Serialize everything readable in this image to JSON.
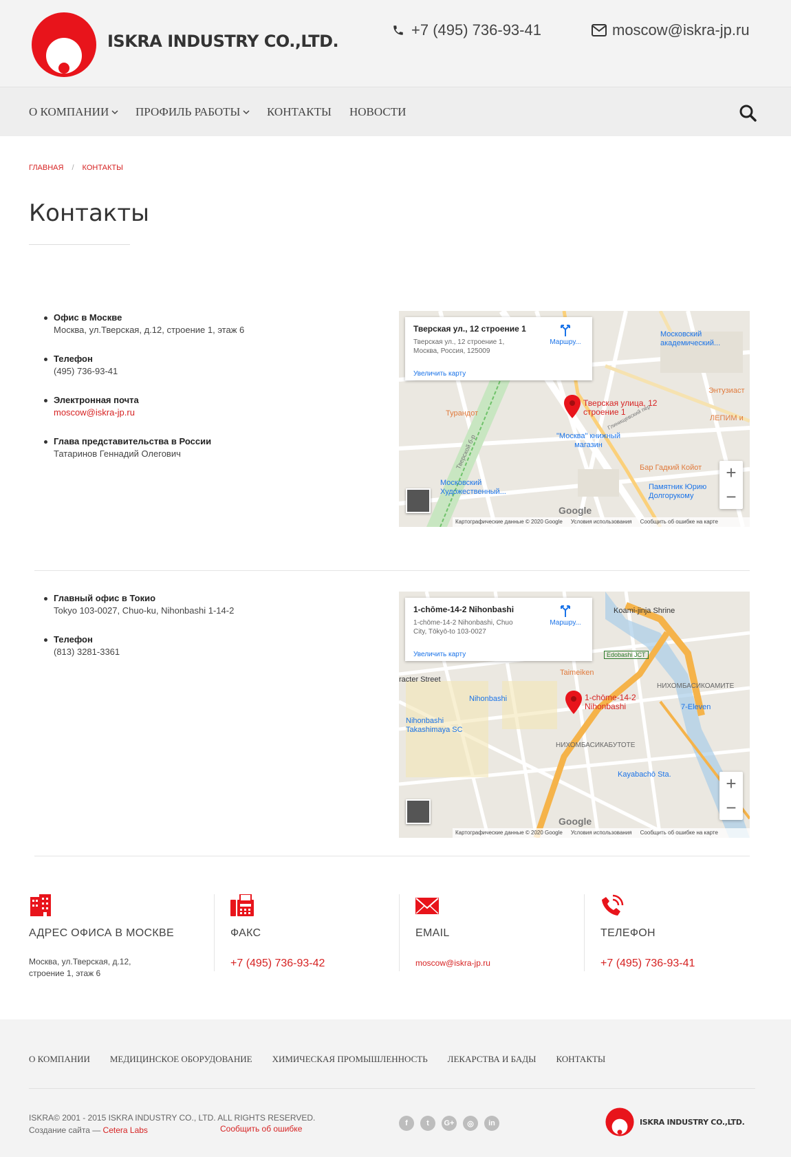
{
  "header": {
    "brand": "ISKRA INDUSTRY CO.,LTD.",
    "phone": "+7 (495) 736-93-41",
    "email": "moscow@iskra-jp.ru",
    "accent_color": "#e8141b"
  },
  "nav": {
    "items": [
      {
        "label": "О КОМПАНИИ",
        "dropdown": true
      },
      {
        "label": "ПРОФИЛЬ РАБОТЫ",
        "dropdown": true
      },
      {
        "label": "КОНТАКТЫ",
        "dropdown": false
      },
      {
        "label": "НОВОСТИ",
        "dropdown": false
      }
    ]
  },
  "breadcrumb": {
    "home": "ГЛАВНАЯ",
    "separator": "/",
    "current": "КОНТАКТЫ"
  },
  "page": {
    "title": "Контакты"
  },
  "moscow": {
    "items": [
      {
        "label": "Офис в Москве",
        "value": "Москва, ул.Тверская, д.12, строение 1, этаж 6"
      },
      {
        "label": "Телефон",
        "value": "(495) 736-93-41"
      },
      {
        "label": "Электронная почта",
        "value": "moscow@iskra-jp.ru"
      },
      {
        "label": "Глава представительства в России",
        "value": "Татаринов Геннадий Олегович"
      }
    ],
    "map": {
      "card_title": "Тверская ул., 12 строение 1",
      "card_address": "Тверская ул., 12 строение 1, Москва, Россия, 125009",
      "zoom_link": "Увеличить карту",
      "route": "Маршру...",
      "pin_label": "Тверская улица, 12 строение 1",
      "labels": [
        "Московский академический...",
        "Турандот",
        "\"Москва\" книжный магазин",
        "Бар Гадкий Койот",
        "Памятник Юрию Долгорукому",
        "Московский Художественный...",
        "Энтузиаст",
        "ЛЕПИМ и",
        "Тверской б-р",
        "Глинищевский пер"
      ],
      "attribution": [
        "Картографические данные © 2020 Google",
        "Условия использования",
        "Сообщить об ошибке на карте"
      ],
      "google": "Google",
      "zoom_in": "+",
      "zoom_out": "−"
    }
  },
  "tokyo": {
    "items": [
      {
        "label": "Главный офис в Токио",
        "value": "Tokyo 103-0027, Chuo-ku, Nihonbashi 1-14-2"
      },
      {
        "label": "Телефон",
        "value": "(813) 3281-3361"
      }
    ],
    "map": {
      "card_title": "1-chōme-14-2 Nihonbashi",
      "card_address": "1-chōme-14-2 Nihonbashi, Chuo City, Tōkyō-to 103-0027",
      "zoom_link": "Увеличить карту",
      "route": "Маршру...",
      "pin_label": "1-chōme-14-2 Nihonbashi",
      "labels": [
        "Koami-jinja Shrine",
        "Taimeiken",
        "Nihonbashi",
        "Nihonbashi Takashimaya SC",
        "НИХОМБАСИКОАМИТЕ",
        "7-Eleven",
        "НИХОМБАСИКАБУТОТЕ",
        "Kayabachō Sta.",
        "racter Street",
        "Edobashi JCT"
      ],
      "attribution": [
        "Картографические данные © 2020 Google",
        "Условия использования",
        "Сообщить об ошибке на карте"
      ],
      "google": "Google",
      "zoom_in": "+",
      "zoom_out": "−"
    }
  },
  "features": [
    {
      "icon": "building-icon",
      "title": "АДРЕС ОФИСА В МОСКВЕ",
      "value": "Москва, ул.Тверская, д.12,",
      "value2": "строение 1, этаж 6"
    },
    {
      "icon": "fax-icon",
      "title": "ФАКС",
      "value": "+7 (495) 736-93-42"
    },
    {
      "icon": "envelope-icon",
      "title": "EMAIL",
      "value": "moscow@iskra-jp.ru"
    },
    {
      "icon": "phone-icon",
      "title": "ТЕЛЕФОН",
      "value": "+7 (495) 736-93-41"
    }
  ],
  "footer": {
    "nav": [
      "О КОМПАНИИ",
      "МЕДИЦИНСКОЕ ОБОРУДОВАНИЕ",
      "ХИМИЧЕСКАЯ ПРОМЫШЛЕННОСТЬ",
      "ЛЕКАРСТВА И БАДЫ",
      "КОНТАКТЫ"
    ],
    "copyright": "ISKRA© 2001 - 2015 ISKRA INDUSTRY CO., LTD. ALL RIGHTS RESERVED.",
    "created_prefix": "Создание сайта —",
    "created_link": "Cetera Labs",
    "report": "Сообщить об ошибке",
    "socials": [
      {
        "icon": "facebook-icon",
        "glyph": "f"
      },
      {
        "icon": "twitter-icon",
        "glyph": "t"
      },
      {
        "icon": "google-plus-icon",
        "glyph": "G+"
      },
      {
        "icon": "instagram-icon",
        "glyph": "◎"
      },
      {
        "icon": "linkedin-icon",
        "glyph": "in"
      }
    ],
    "brand": "ISKRA INDUSTRY CO.,LTD."
  }
}
